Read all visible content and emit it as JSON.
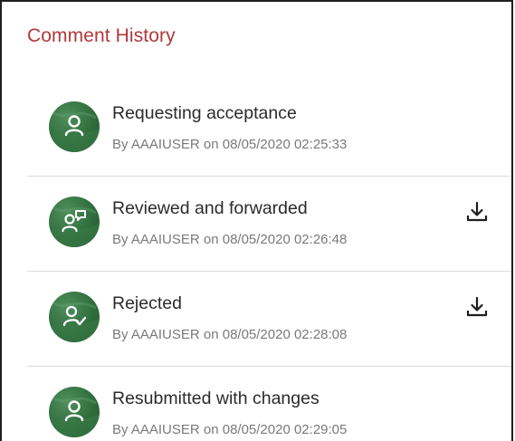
{
  "panel": {
    "title": "Comment History"
  },
  "items": [
    {
      "label": "Requesting acceptance",
      "meta": "By AAAIUSER on 08/05/2020 02:25:33",
      "icon": "user-icon",
      "has_download": false
    },
    {
      "label": "Reviewed and forwarded",
      "meta": "By AAAIUSER on 08/05/2020 02:26:48",
      "icon": "user-comment-icon",
      "has_download": true
    },
    {
      "label": "Rejected",
      "meta": "By AAAIUSER on 08/05/2020 02:28:08",
      "icon": "user-check-icon",
      "has_download": true
    },
    {
      "label": "Resubmitted with changes",
      "meta": "By AAAIUSER on 08/05/2020 02:29:05",
      "icon": "user-icon",
      "has_download": false
    }
  ],
  "colors": {
    "title": "#b2373a",
    "avatar": "#2f6d3d",
    "divider": "#dcdcdc"
  }
}
